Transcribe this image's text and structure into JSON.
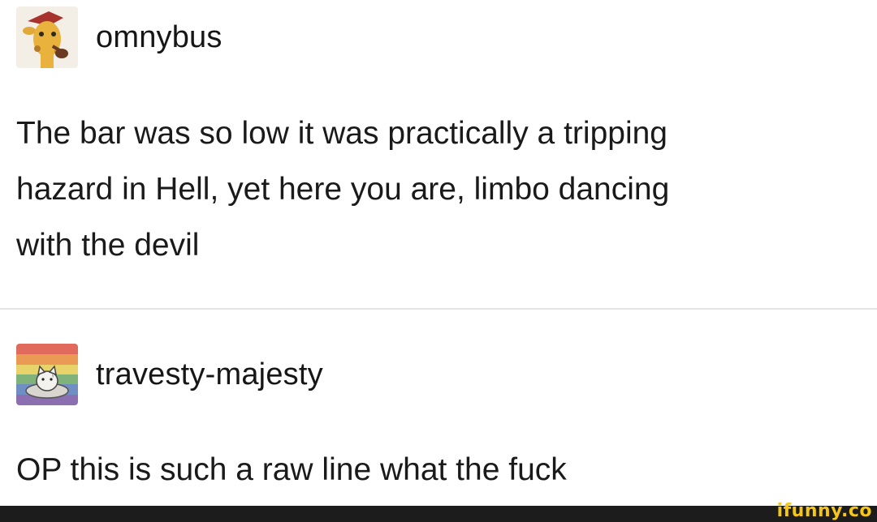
{
  "posts": [
    {
      "username": "omnybus",
      "avatar_icon": "giraffe-avatar-icon",
      "lines": [
        "The bar was so low it was practically a tripping",
        "hazard in Hell, yet here you are, limbo dancing",
        "with the devil"
      ]
    },
    {
      "username": "travesty-majesty",
      "avatar_icon": "cat-on-rainbow-avatar-icon",
      "lines": [
        "OP this is such a raw line what the fuck"
      ]
    }
  ],
  "watermark": "ifunny.co",
  "colors": {
    "text": "#1a1a1a",
    "divider": "#e4e4e4",
    "watermark": "#f5c518",
    "footer": "#1c1c1c"
  }
}
